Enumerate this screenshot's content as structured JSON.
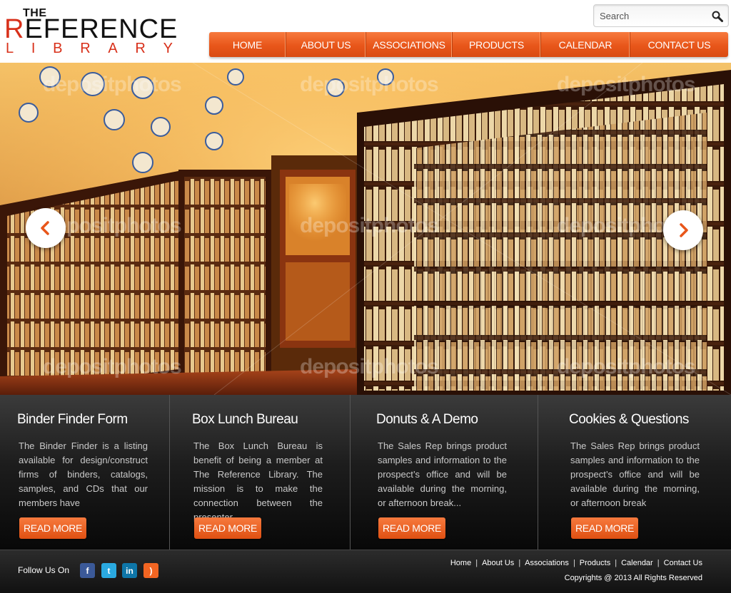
{
  "brand": {
    "the": "THE",
    "reference_prefix": "R",
    "reference_rest": "EFERENCE",
    "library_letters": [
      "L",
      "I",
      "B",
      "R",
      "A",
      "R",
      "Y"
    ]
  },
  "search": {
    "placeholder": "Search"
  },
  "nav": {
    "items": [
      "HOME",
      "ABOUT US",
      "ASSOCIATIONS",
      "PRODUCTS",
      "CALENDAR",
      "CONTACT US"
    ]
  },
  "hero": {
    "watermark": "depositphotos"
  },
  "features": [
    {
      "title": "Binder Finder Form",
      "text": "The Binder Finder is a listing available for design/construct firms of binders, catalogs, samples, and CDs that our members have",
      "button": "READ MORE"
    },
    {
      "title": "Box Lunch Bureau",
      "text": "The Box Lunch Bureau is benefit of being a member at The Reference Library. The mission is to make the connection between the presenter....",
      "button": "READ MORE"
    },
    {
      "title": "Donuts & A Demo",
      "text": "The Sales Rep brings product samples and information to the prospect’s office and will be available during the morning, or afternoon break...",
      "button": "READ MORE"
    },
    {
      "title": "Cookies & Questions",
      "text": "The Sales Rep brings product samples and information to the prospect’s office and will be available during the morning, or afternoon break",
      "button": "READ MORE"
    }
  ],
  "footer": {
    "follow_label": "Follow Us On",
    "social": [
      {
        "icon": "facebook-icon",
        "glyph": "f",
        "color": "#3b5998"
      },
      {
        "icon": "twitter-icon",
        "glyph": "t",
        "color": "#2aa9e0"
      },
      {
        "icon": "linkedin-icon",
        "glyph": "in",
        "color": "#0e76a8"
      },
      {
        "icon": "rss-icon",
        "glyph": ")",
        "color": "#f26522"
      }
    ],
    "links": [
      "Home",
      "About Us",
      "Associations",
      "Products",
      "Calendar",
      "Contact Us"
    ],
    "copyright": "Copyrights @ 2013 All Rights Reserved"
  },
  "colors": {
    "accent": "#e8561a",
    "brand_red": "#d8301a"
  }
}
